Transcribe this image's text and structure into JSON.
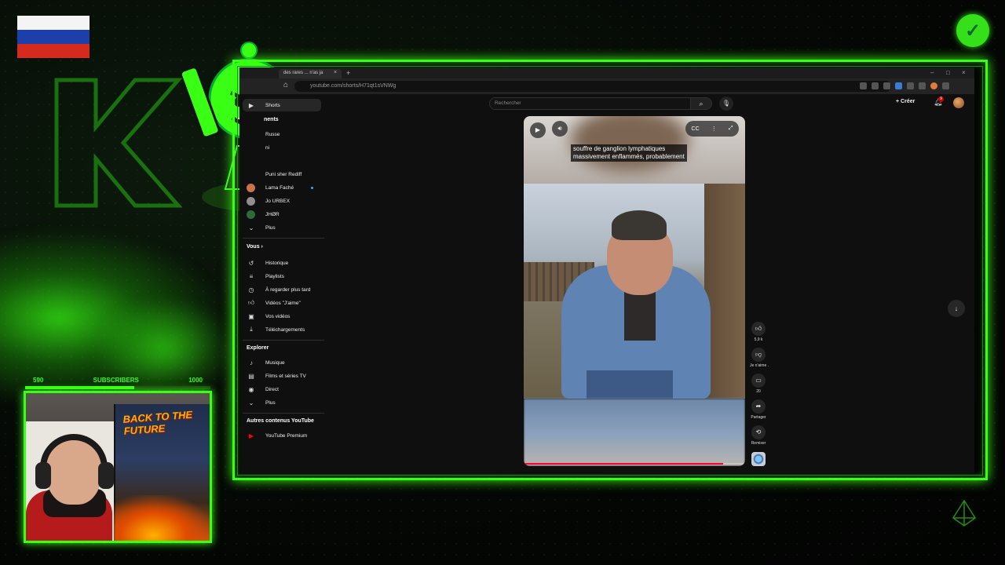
{
  "overlay": {
    "sub_goal": {
      "current_label": "590",
      "title": "SUBSCRIBERS",
      "target_label": "1000",
      "progress": 0.59
    },
    "poster_text": "BACK TO THE FUTURE",
    "colors": {
      "accent": "#39ff14",
      "flag_white": "#ffffff",
      "flag_blue": "#1c3faa",
      "flag_red": "#d52b1e"
    },
    "icons": [
      "russian-flag-icon",
      "verified-check-icon",
      "k-logo-icon",
      "chess-pawn-mascot-icon",
      "corner-emblem-icon"
    ]
  },
  "browser": {
    "tab_title": "des rares ... n'as ja",
    "url": "youtube.com/shorts/H71qt1sVNWg",
    "window_controls": [
      "–",
      "□",
      "×"
    ]
  },
  "youtube": {
    "search_placeholder": "Rechercher",
    "create_label": "Créer",
    "notification_count": "9",
    "sidebar": {
      "shorts": "Shorts",
      "subscriptions_fragment": "nents",
      "channels": [
        {
          "label": "Russe"
        },
        {
          "label": "ni"
        },
        {
          "label": "Puni sher Rediff"
        },
        {
          "label": "Lama Faché",
          "color": "#c9734a"
        },
        {
          "label": "Jo URBEX",
          "color": "#8f8f8f"
        },
        {
          "label": "JHØR",
          "color": "#2e6b3a"
        }
      ],
      "more": "Plus",
      "vous_header": "Vous",
      "vous_items": [
        {
          "icon": "history-icon",
          "label": "Historique"
        },
        {
          "icon": "playlists-icon",
          "label": "Playlists"
        },
        {
          "icon": "watch-later-icon",
          "label": "À regarder plus tard"
        },
        {
          "icon": "like-icon",
          "label": "Vidéos \"J'aime\""
        },
        {
          "icon": "your-videos-icon",
          "label": "Vos vidéos"
        },
        {
          "icon": "download-icon",
          "label": "Téléchargements"
        }
      ],
      "explorer_header": "Explorer",
      "explorer_items": [
        {
          "icon": "music-icon",
          "label": "Musique"
        },
        {
          "icon": "movies-icon",
          "label": "Films et séries TV"
        },
        {
          "icon": "live-icon",
          "label": "Direct"
        },
        {
          "icon": "chevron-down-icon",
          "label": "Plus"
        }
      ],
      "other_header": "Autres contenus YouTube",
      "other_item": "YouTube Premium"
    },
    "short": {
      "caption_line1": "souffre de ganglion lymphatiques",
      "caption_line2": "massivement enflammés, probablement",
      "progress": 0.9
    },
    "actions": {
      "like_count": "5,9 k",
      "dislike_label": "Je n'aime .",
      "comments_count": "20",
      "share_label": "Partager",
      "remix_label": "Remixer"
    }
  }
}
